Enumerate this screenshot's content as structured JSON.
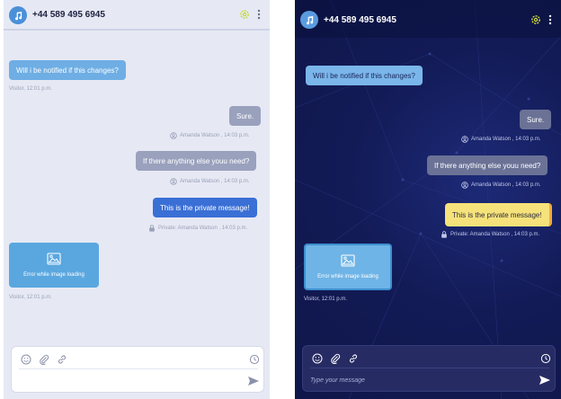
{
  "header": {
    "phone": "+44 589 495 6945"
  },
  "messages": {
    "visitor_question": "Will i be notified if this changes?",
    "visitor_meta": "Visitor, 12:01 p.m.",
    "agent_sure": "Sure.",
    "agent_meta_1": "Amanda Watson , 14:03 p.m.",
    "agent_else": "If there anything else youu need?",
    "agent_meta_2": "Amanda Watson , 14:03 p.m.",
    "private_msg": "This is the private message!",
    "private_meta": "Private: Amanda Watson , 14:03 p.m.",
    "image_error": "Error while image loading",
    "image_meta": "Visitor, 12:01 p.m."
  },
  "composer": {
    "placeholder_dark": "Type your message",
    "placeholder_light": ""
  },
  "icons": {
    "avatar": "music-note-icon",
    "settings": "gear-icon",
    "menu": "kebab-menu-icon",
    "emoji": "emoji-icon",
    "attach": "attach-icon",
    "link": "link-icon",
    "clock": "clock-icon",
    "send": "send-icon",
    "user": "user-circle-icon",
    "lock": "lock-icon",
    "image": "image-icon"
  },
  "colors": {
    "light_bg": "#e6e9f4",
    "dark_bg": "#121a52",
    "visitor_bubble": "#6eaee4",
    "agent_bubble_light": "#9aa1bd",
    "private_light": "#3a6fd6",
    "private_dark": "#f6e27a",
    "settings_accent": "#c6d63a"
  }
}
